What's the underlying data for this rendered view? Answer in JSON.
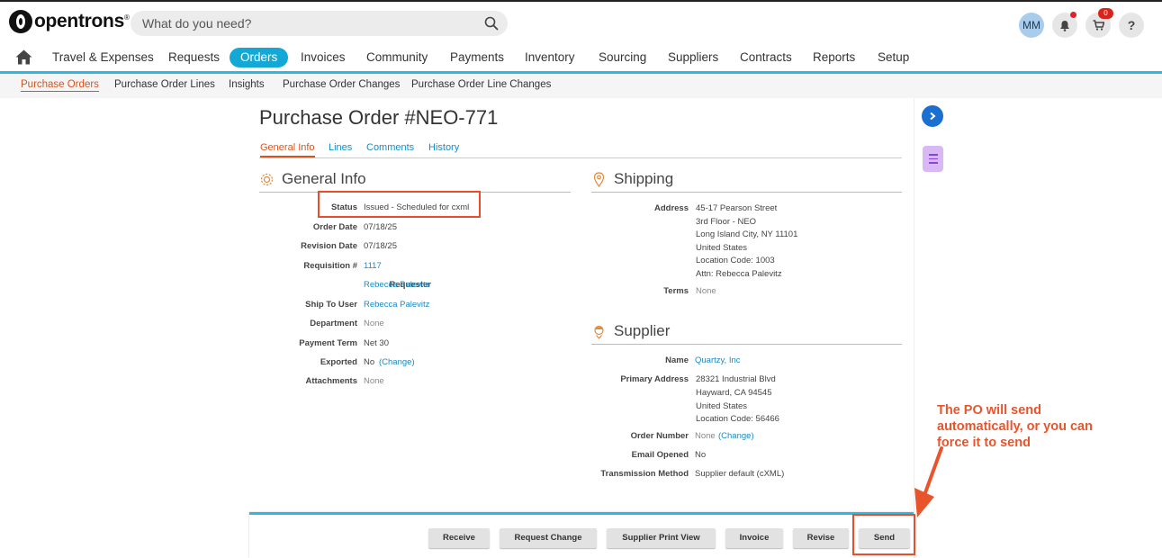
{
  "brand": {
    "logo_text": "opentrons",
    "logo_mark": "®"
  },
  "search": {
    "placeholder": "What do you need?"
  },
  "header": {
    "avatar_initials": "MM",
    "cart_count": "0",
    "help_label": "?"
  },
  "main_nav": {
    "items": [
      {
        "label": "Travel & Expenses"
      },
      {
        "label": "Requests"
      },
      {
        "label": "Orders"
      },
      {
        "label": "Invoices"
      },
      {
        "label": "Community"
      },
      {
        "label": "Payments"
      },
      {
        "label": "Inventory"
      },
      {
        "label": "Sourcing"
      },
      {
        "label": "Suppliers"
      },
      {
        "label": "Contracts"
      },
      {
        "label": "Reports"
      },
      {
        "label": "Setup"
      }
    ],
    "active": "Orders"
  },
  "sub_nav": {
    "items": [
      {
        "label": "Purchase Orders"
      },
      {
        "label": "Purchase Order Lines"
      },
      {
        "label": "Insights"
      },
      {
        "label": "Purchase Order Changes"
      },
      {
        "label": "Purchase Order Line Changes"
      }
    ],
    "active": "Purchase Orders"
  },
  "page": {
    "title": "Purchase Order #NEO-771",
    "tabs": [
      {
        "label": "General Info"
      },
      {
        "label": "Lines"
      },
      {
        "label": "Comments"
      },
      {
        "label": "History"
      }
    ],
    "active_tab": "General Info"
  },
  "general_info": {
    "heading": "General Info",
    "fields": {
      "status": {
        "label": "Status",
        "value": "Issued - Scheduled for cxml"
      },
      "order_date": {
        "label": "Order Date",
        "value": "07/18/25"
      },
      "revision_date": {
        "label": "Revision Date",
        "value": "07/18/25"
      },
      "requisition": {
        "label": "Requisition #",
        "value": "1117"
      },
      "requester": {
        "label": "Requester",
        "value": "Rebecca Palevitz"
      },
      "ship_to_user": {
        "label": "Ship To User",
        "value": "Rebecca Palevitz"
      },
      "department": {
        "label": "Department",
        "value": "None"
      },
      "payment_term": {
        "label": "Payment Term",
        "value": "Net 30"
      },
      "exported": {
        "label": "Exported",
        "value": "No",
        "change_link": "(Change)"
      },
      "attachments": {
        "label": "Attachments",
        "value": "None"
      }
    }
  },
  "shipping": {
    "heading": "Shipping",
    "address_label": "Address",
    "address_lines": [
      "45-17 Pearson Street",
      "3rd Floor - NEO",
      "Long Island City, NY 11101",
      "United States",
      "Location Code: 1003",
      "Attn: Rebecca Palevitz"
    ],
    "terms_label": "Terms",
    "terms_value": "None"
  },
  "supplier": {
    "heading": "Supplier",
    "name_label": "Name",
    "name_value": "Quartzy, Inc",
    "primary_address_label": "Primary Address",
    "primary_address_lines": [
      "28321 Industrial Blvd",
      "Hayward, CA 94545",
      "United States",
      "Location Code: 56466"
    ],
    "order_number_label": "Order Number",
    "order_number_value": "None",
    "order_number_change": "(Change)",
    "email_opened_label": "Email Opened",
    "email_opened_value": "No",
    "transmission_label": "Transmission Method",
    "transmission_value": "Supplier default (cXML)"
  },
  "actions": {
    "receive": "Receive",
    "request_change": "Request Change",
    "supplier_print_view": "Supplier Print View",
    "invoice": "Invoice",
    "revise": "Revise",
    "send": "Send"
  },
  "annotation": {
    "line1": "The PO will send",
    "line2": "automatically, or you can",
    "line3": "force it to send",
    "color": "#e9542b"
  },
  "colors": {
    "accent": "#13a8d6",
    "active_tab": "#d9541c",
    "link": "#1a8bc2",
    "highlight": "#e94e2a"
  }
}
